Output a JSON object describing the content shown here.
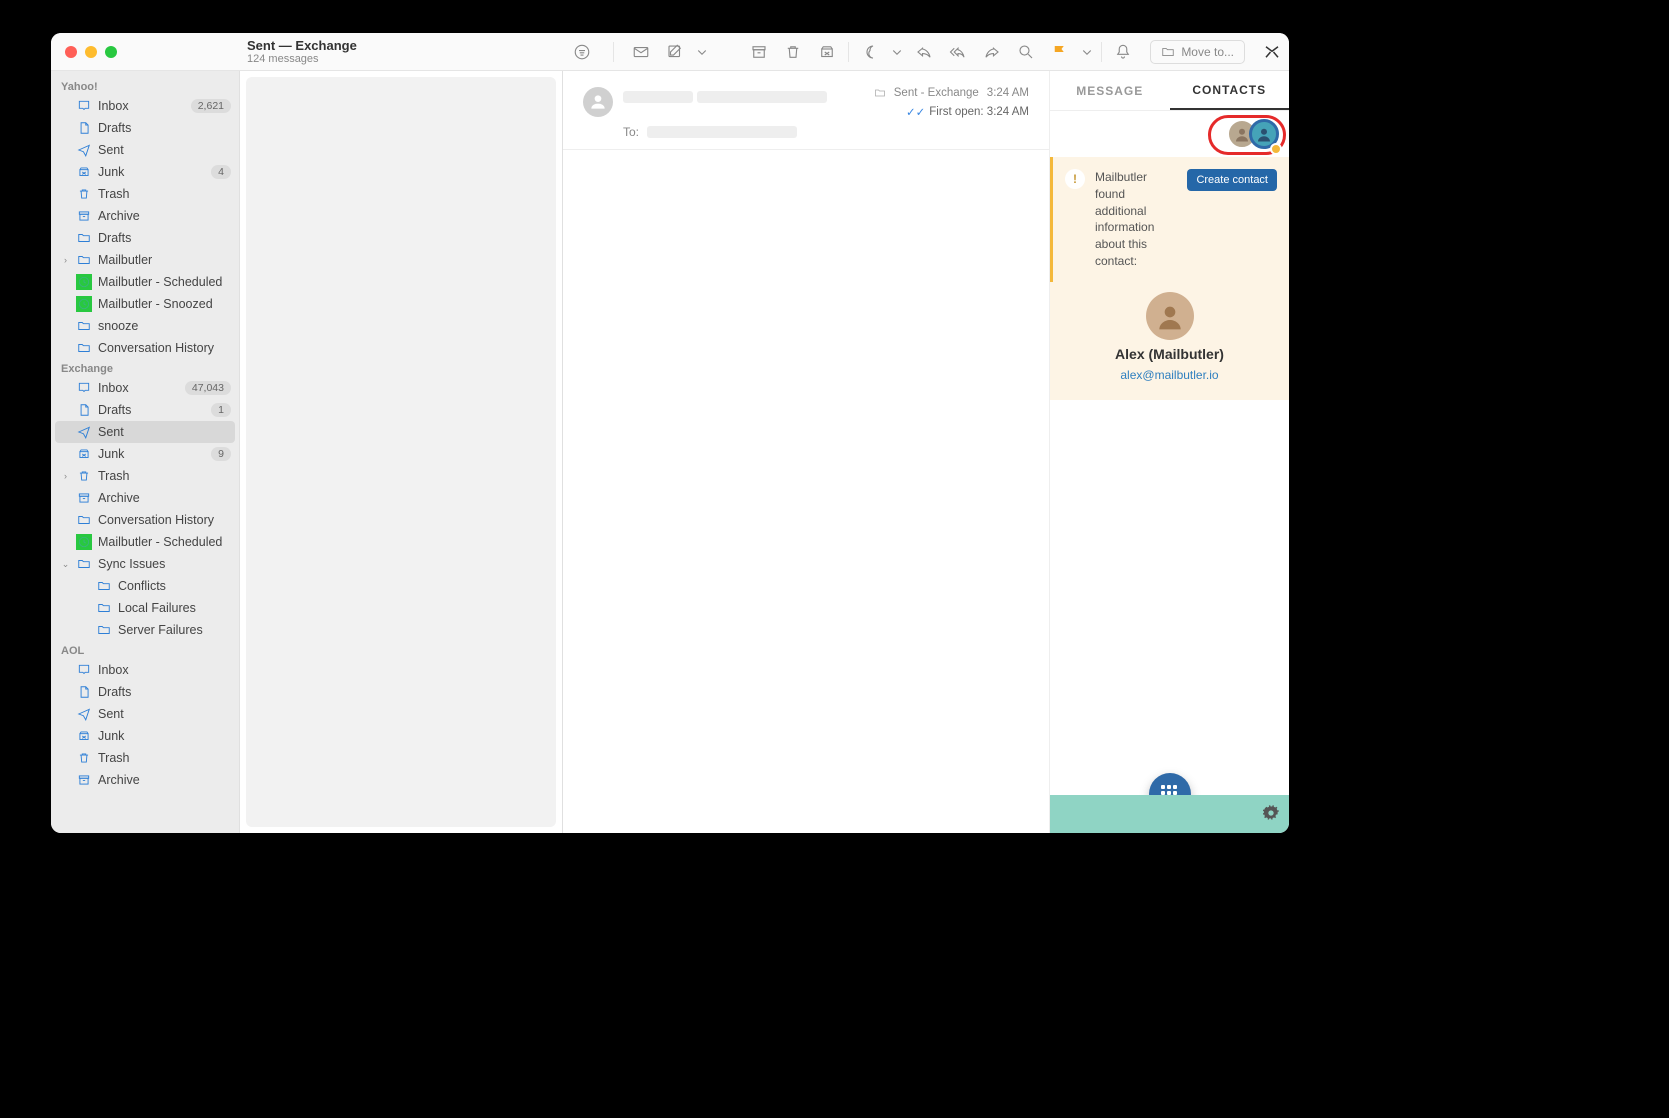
{
  "header": {
    "title": "Sent — Exchange",
    "subtitle": "124 messages",
    "move_to": "Move to..."
  },
  "accounts": [
    {
      "name": "Yahoo!",
      "folders": [
        {
          "icon": "inbox",
          "label": "Inbox",
          "badge": "2,621"
        },
        {
          "icon": "draft",
          "label": "Drafts"
        },
        {
          "icon": "sent",
          "label": "Sent"
        },
        {
          "icon": "junk",
          "label": "Junk",
          "badge": "4"
        },
        {
          "icon": "trash",
          "label": "Trash"
        },
        {
          "icon": "archive",
          "label": "Archive"
        },
        {
          "icon": "folder",
          "label": "Drafts"
        },
        {
          "icon": "folder",
          "label": "Mailbutler",
          "disc": ">"
        },
        {
          "icon": "clock",
          "label": "Mailbutler - Scheduled",
          "iconColor": "green"
        },
        {
          "icon": "clock",
          "label": "Mailbutler - Snoozed",
          "iconColor": "green"
        },
        {
          "icon": "folder",
          "label": "snooze"
        },
        {
          "icon": "folder",
          "label": "Conversation History"
        }
      ]
    },
    {
      "name": "Exchange",
      "folders": [
        {
          "icon": "inbox",
          "label": "Inbox",
          "badge": "47,043"
        },
        {
          "icon": "draft",
          "label": "Drafts",
          "badge": "1"
        },
        {
          "icon": "sent",
          "label": "Sent",
          "selected": true
        },
        {
          "icon": "junk",
          "label": "Junk",
          "badge": "9"
        },
        {
          "icon": "trash",
          "label": "Trash",
          "disc": ">"
        },
        {
          "icon": "archive",
          "label": "Archive"
        },
        {
          "icon": "folder",
          "label": "Conversation History"
        },
        {
          "icon": "clock",
          "label": "Mailbutler - Scheduled",
          "iconColor": "green"
        },
        {
          "icon": "folder",
          "label": "Sync Issues",
          "disc": "v"
        },
        {
          "icon": "folder",
          "label": "Conflicts",
          "child": true
        },
        {
          "icon": "folder",
          "label": "Local Failures",
          "child": true
        },
        {
          "icon": "folder",
          "label": "Server Failures",
          "child": true
        }
      ]
    },
    {
      "name": "AOL",
      "folders": [
        {
          "icon": "inbox",
          "label": "Inbox"
        },
        {
          "icon": "draft",
          "label": "Drafts"
        },
        {
          "icon": "sent",
          "label": "Sent"
        },
        {
          "icon": "junk",
          "label": "Junk"
        },
        {
          "icon": "trash",
          "label": "Trash"
        },
        {
          "icon": "archive",
          "label": "Archive"
        }
      ]
    }
  ],
  "message": {
    "folder": "Sent - Exchange",
    "time": "3:24 AM",
    "first_open": "First open: 3:24 AM",
    "to_label": "To:"
  },
  "panel": {
    "tab_message": "MESSAGE",
    "tab_contacts": "CONTACTS",
    "info_text": "Mailbutler found additional information about this contact:",
    "create_btn": "Create contact",
    "contact_name": "Alex (Mailbutler)",
    "contact_email": "alex@mailbutler.io"
  }
}
